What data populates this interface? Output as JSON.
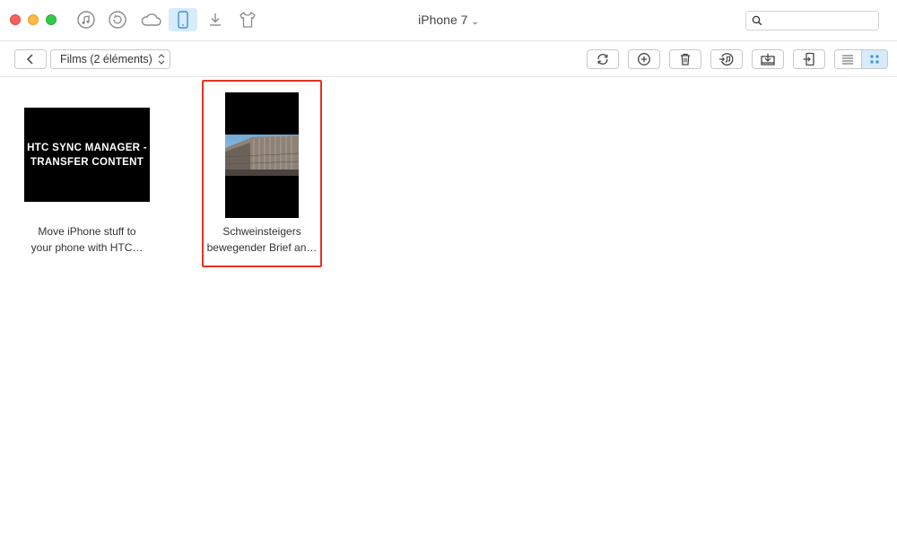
{
  "window": {
    "device_title": "iPhone 7",
    "search": {
      "placeholder": "",
      "value": ""
    }
  },
  "top_icons": [
    {
      "name": "itunes-music-icon",
      "active": false
    },
    {
      "name": "backup-restore-icon",
      "active": false
    },
    {
      "name": "icloud-icon",
      "active": false
    },
    {
      "name": "iphone-device-icon",
      "active": true
    },
    {
      "name": "download-icon",
      "active": false
    },
    {
      "name": "tshirt-icon",
      "active": false
    }
  ],
  "toolbar": {
    "breadcrumb": "Films (2 éléments)",
    "actions": [
      "refresh-icon",
      "add-icon",
      "trash-icon",
      "to-itunes-icon",
      "to-computer-icon",
      "to-device-icon"
    ],
    "views": [
      "list-view-icon",
      "grid-view-icon"
    ],
    "selected_view": "grid"
  },
  "items": [
    {
      "thumb_text_line1": "HTC SYNC MANAGER -",
      "thumb_text_line2": "TRANSFER CONTENT",
      "caption_line1": "Move iPhone stuff to",
      "caption_line2": "your phone with HTC…",
      "selected": false
    },
    {
      "caption_line1": "Schweinsteigers",
      "caption_line2": "bewegender Brief an…",
      "selected": true
    }
  ],
  "colors": {
    "accent": "#d7ebfa",
    "icon_active": "#3d8fd9",
    "selection_border": "#e8321f"
  }
}
